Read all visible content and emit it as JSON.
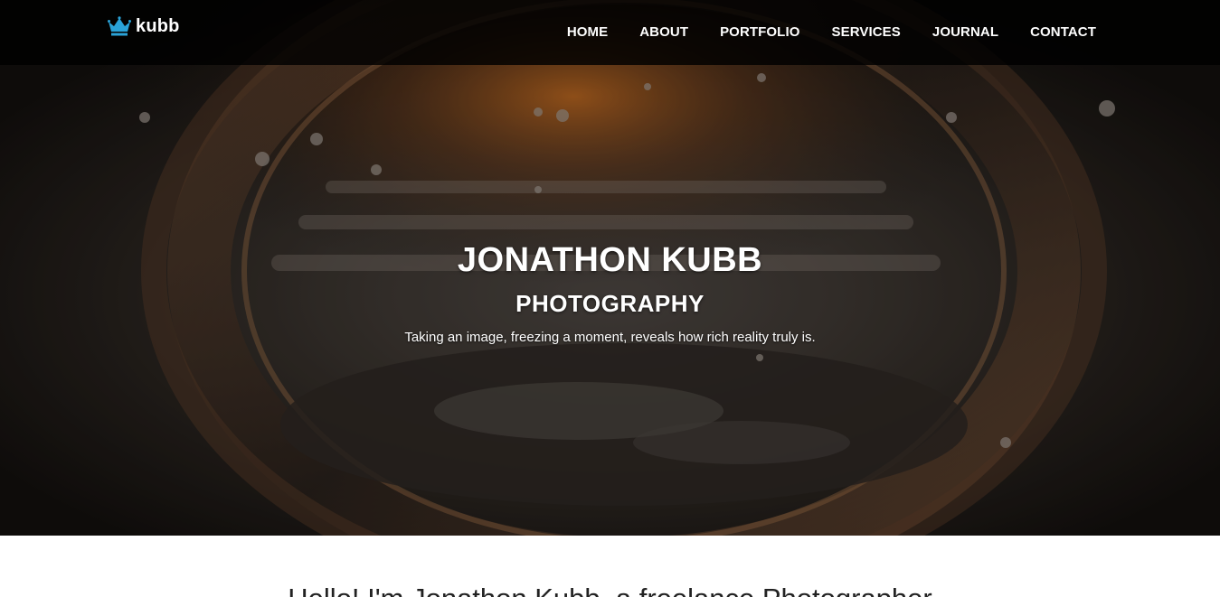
{
  "brand": {
    "name": "kubb",
    "icon": "crown-icon",
    "icon_color": "#2aa3d8"
  },
  "nav": {
    "items": [
      {
        "label": "HOME"
      },
      {
        "label": "ABOUT"
      },
      {
        "label": "PORTFOLIO"
      },
      {
        "label": "SERVICES"
      },
      {
        "label": "JOURNAL"
      },
      {
        "label": "CONTACT"
      }
    ]
  },
  "hero": {
    "title": "JONATHON KUBB",
    "subtitle": "PHOTOGRAPHY",
    "tagline": "Taking an image, freezing a moment, reveals how rich reality truly is."
  },
  "intro": {
    "heading": "Hello! I'm Jonathon Kubb, a freelance Photographer"
  },
  "colors": {
    "navbar_bg": "#000000",
    "accent": "#2aa3d8",
    "text_light": "#ffffff",
    "text_dark": "#222222"
  }
}
